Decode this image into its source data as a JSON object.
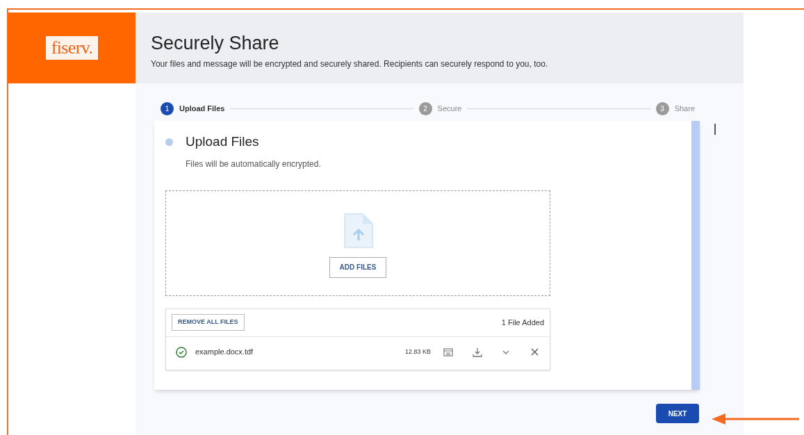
{
  "logo": {
    "text": "fiserv."
  },
  "header": {
    "title": "Securely Share",
    "subtitle": "Your files and message will be encrypted and securely shared. Recipients can securely respond to you, too."
  },
  "steps": [
    {
      "number": "1",
      "label": "Upload Files",
      "selected": true
    },
    {
      "number": "2",
      "label": "Secure",
      "selected": false
    },
    {
      "number": "3",
      "label": "Share",
      "selected": false
    }
  ],
  "card": {
    "title": "Upload Files",
    "subtitle": "Files will be automatically encrypted.",
    "add_button": "ADD FILES",
    "remove_all_button": "REMOVE ALL FILES",
    "count": "1 File Added",
    "files": [
      {
        "name": "example.docx.tdf",
        "size": "12.83 KB",
        "verified": true
      }
    ]
  },
  "next_button": "NEXT"
}
